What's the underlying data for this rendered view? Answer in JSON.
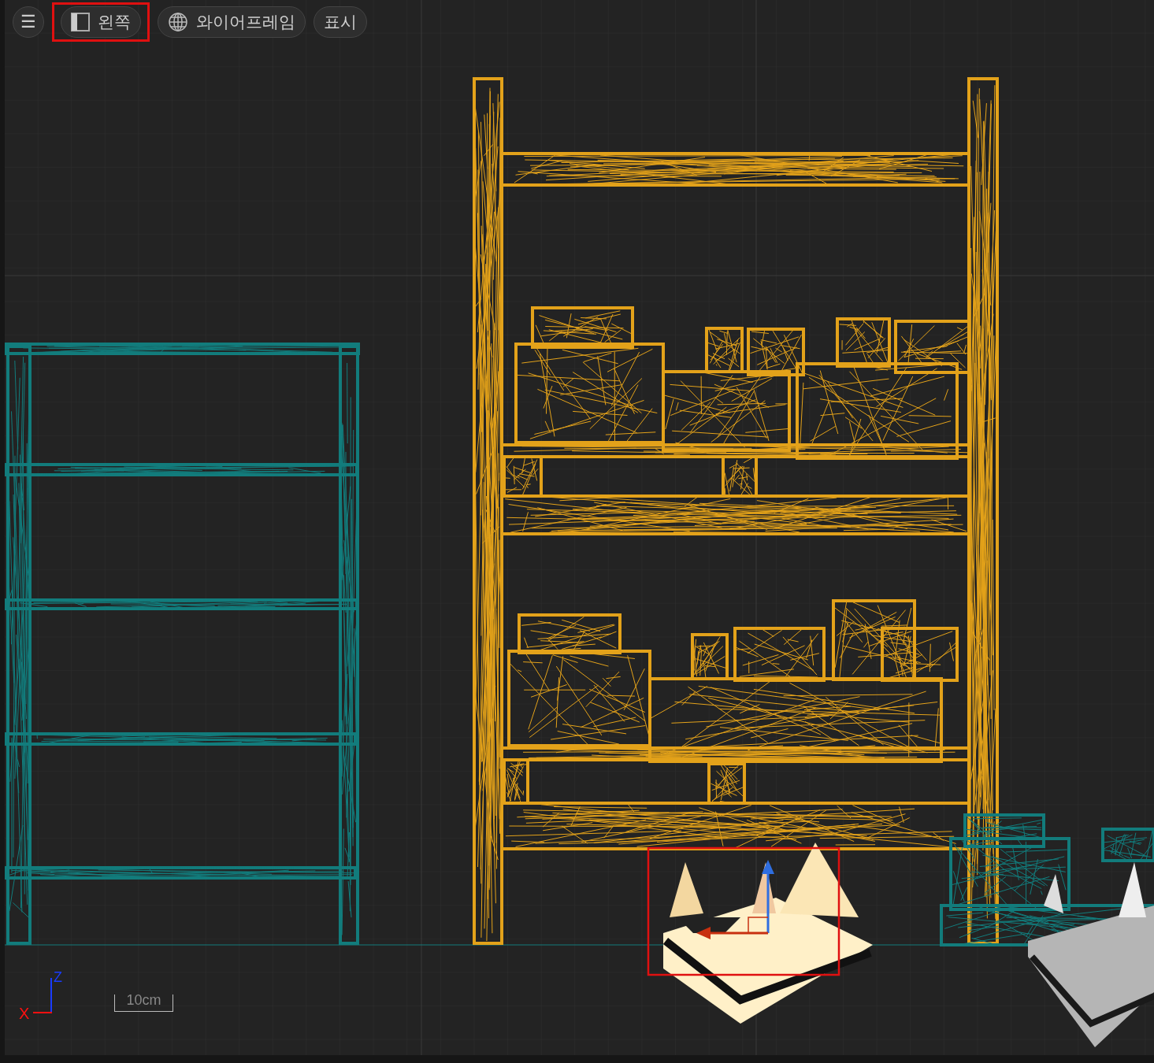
{
  "toolbar": {
    "menu_button": {
      "icon": "☰"
    },
    "buttons": [
      {
        "kind": "view",
        "label": "왼쪽",
        "highlighted": true
      },
      {
        "kind": "shading",
        "label": "와이어프레임",
        "highlighted": false
      },
      {
        "kind": "display",
        "label": "표시",
        "highlighted": false
      }
    ]
  },
  "viewport": {
    "selection_box": true
  },
  "axes": {
    "x": "X",
    "z": "Z"
  },
  "scale_bar": "10cm"
}
